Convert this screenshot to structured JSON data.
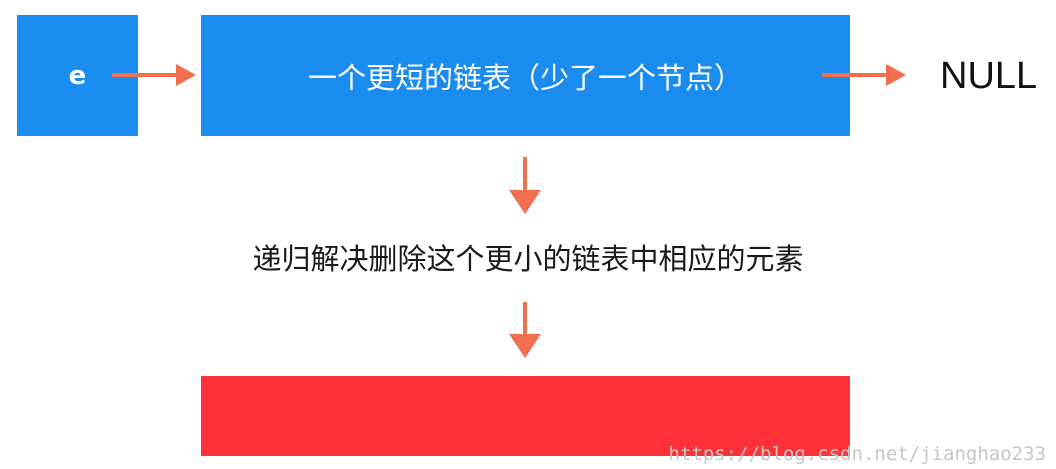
{
  "colors": {
    "blue_box": "#1a8cf0",
    "red_box": "#ff3038",
    "arrow": "#ef6f4e"
  },
  "nodes": {
    "head_label": "e",
    "list_label": "一个更短的链表（少了一个节点）",
    "null_label": "NULL"
  },
  "steps": {
    "recursive_text": "递归解决删除这个更小的链表中相应的元素"
  },
  "watermark": "https://blog.csdn.net/jianghao233"
}
